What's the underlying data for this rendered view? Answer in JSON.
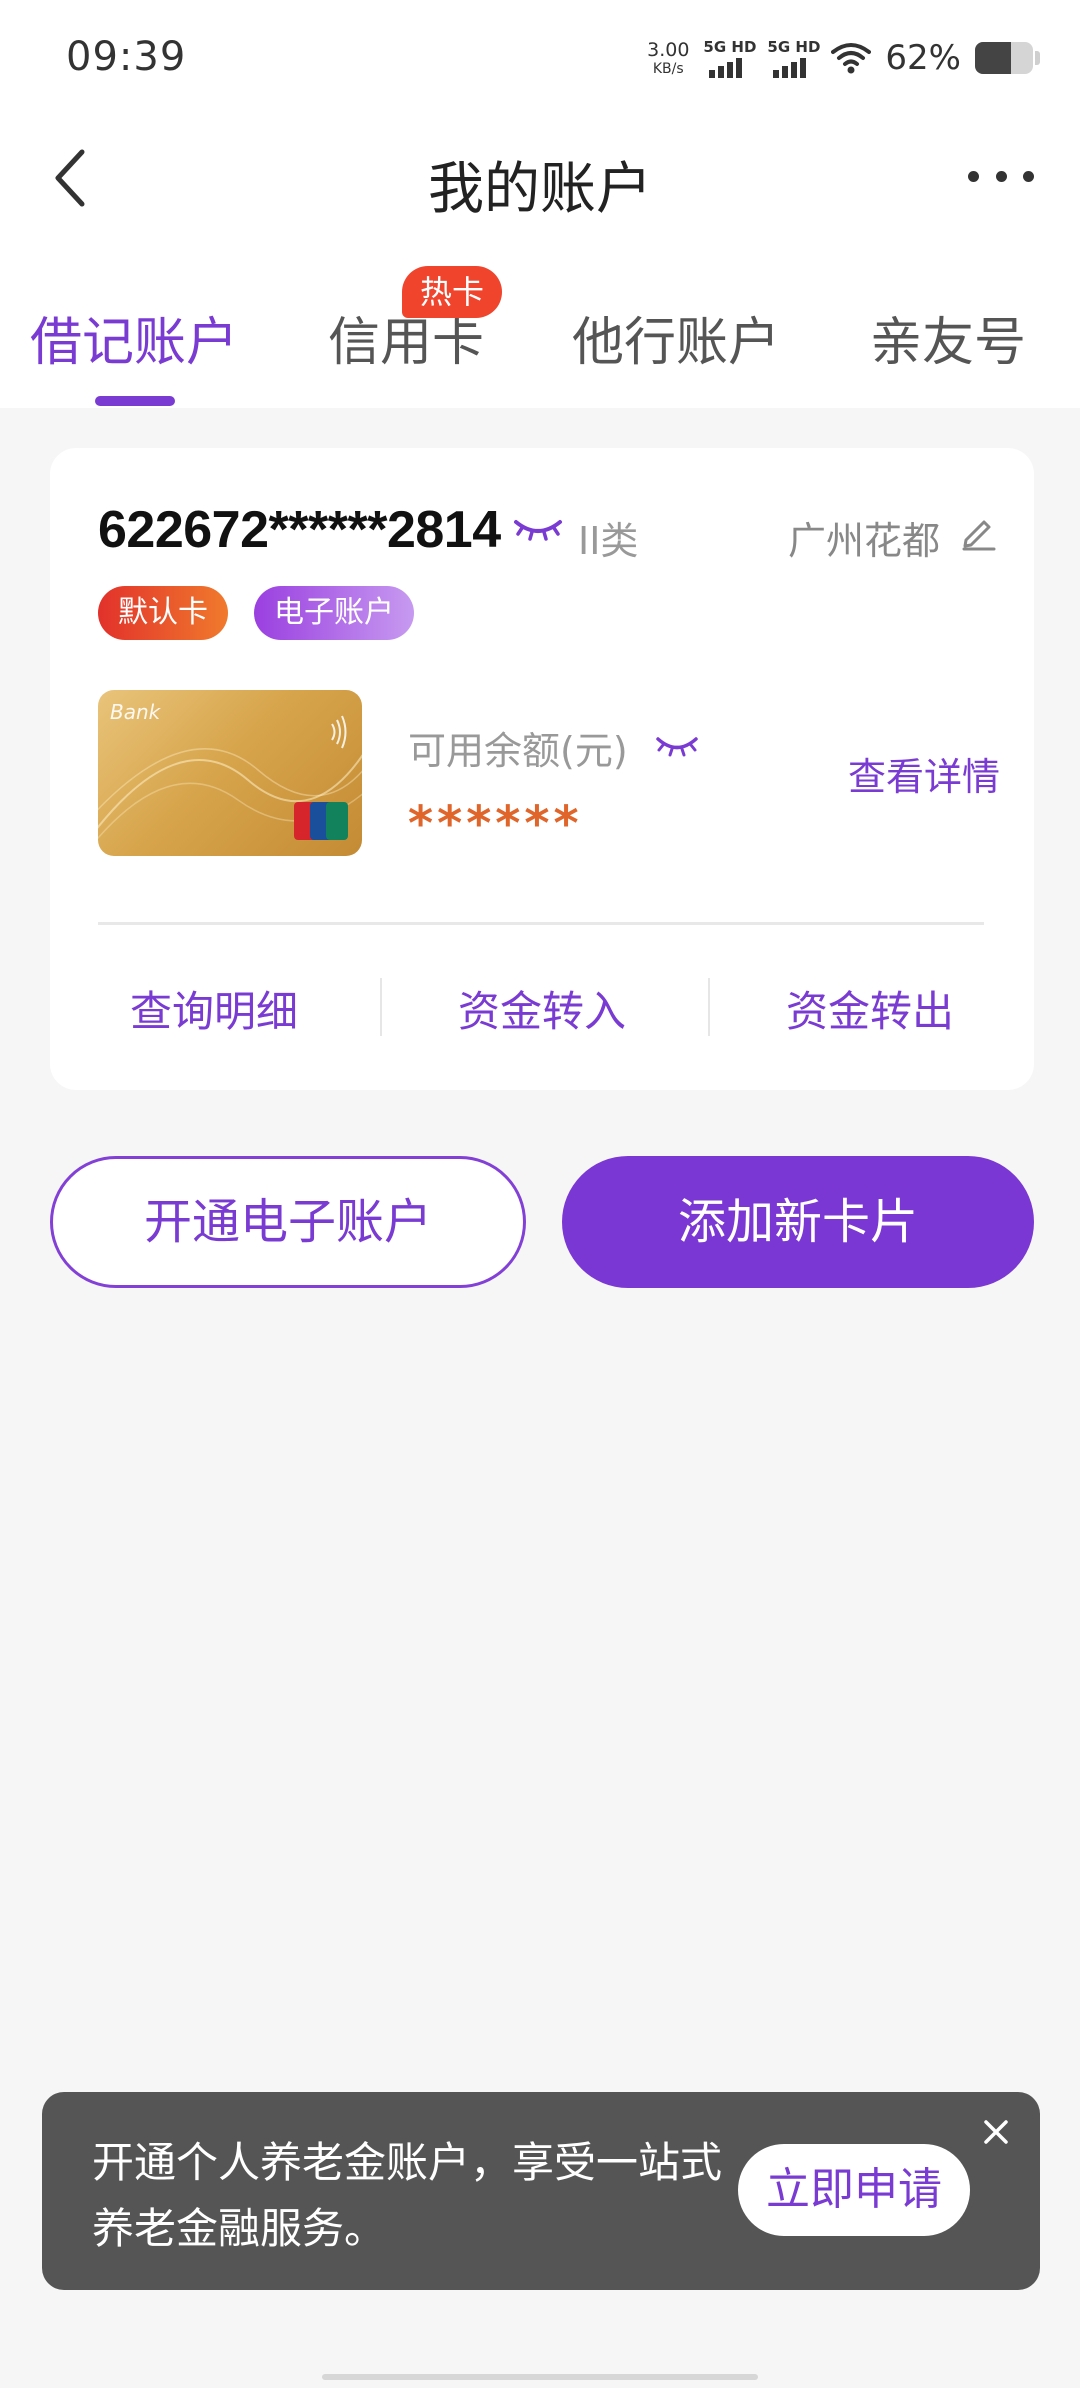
{
  "status_bar": {
    "time": "09:39",
    "net_speed_value": "3.00",
    "net_speed_unit": "KB/s",
    "signal1_label": "5G HD",
    "signal2_label": "5G HD",
    "battery_percent": "62%",
    "battery_level": 0.62
  },
  "header": {
    "title": "我的账户",
    "back_icon": "chevron-left-icon",
    "more_icon": "more-dots-icon"
  },
  "tabs": {
    "items": [
      {
        "label": "借记账户",
        "active": true
      },
      {
        "label": "信用卡",
        "active": false
      },
      {
        "label": "他行账户",
        "active": false
      },
      {
        "label": "亲友号",
        "active": false
      }
    ],
    "badge": "热卡"
  },
  "account": {
    "number": "622672******2814",
    "class": "II类",
    "location": "广州花都",
    "tags": [
      "默认卡",
      "电子账户"
    ],
    "balance_label": "可用余额(元)",
    "balance_masked": "******",
    "detail_link": "查看详情",
    "card_brand": "Bank",
    "actions": [
      "查询明细",
      "资金转入",
      "资金转出"
    ]
  },
  "buttons": {
    "open_e_account": "开通电子账户",
    "add_card": "添加新卡片"
  },
  "promo": {
    "text": "开通个人养老金账户，享受一站式养老金融服务。",
    "button": "立即申请"
  },
  "colors": {
    "accent": "#7a3bd3",
    "hot_badge": "#f0442c",
    "balance": "#e0652a"
  }
}
